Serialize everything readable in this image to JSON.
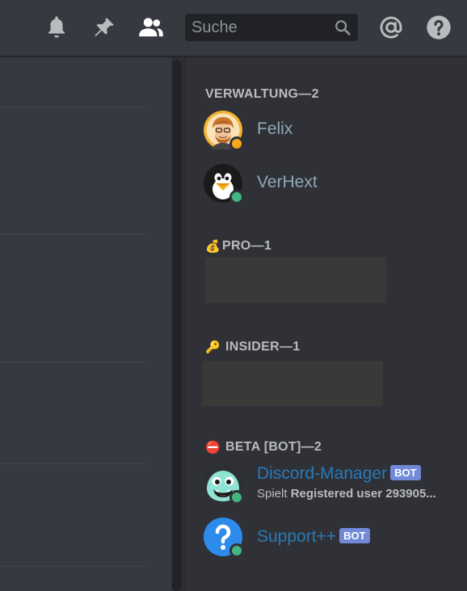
{
  "toolbar": {
    "search_placeholder": "Suche",
    "icons": [
      "bell-icon",
      "pin-icon",
      "members-icon",
      "search-icon",
      "mention-icon",
      "help-icon"
    ]
  },
  "members": {
    "groups": [
      {
        "header": "VERWALTUNG—2",
        "members": [
          {
            "name": "Felix",
            "status": "idle",
            "avatar": "bitmoji-avatar"
          },
          {
            "name": "VerHext",
            "status": "online",
            "avatar": "penguin-avatar"
          }
        ]
      },
      {
        "header": "PRO—1",
        "emoji": "💰",
        "members": []
      },
      {
        "header": "INSIDER—1",
        "emoji": "🔑",
        "members": []
      },
      {
        "header": "BETA [BOT]—2",
        "emoji": "⛔",
        "members": [
          {
            "name": "Discord-Manager",
            "badge": "BOT",
            "status": "online",
            "activity_prefix": "Spielt",
            "activity_value": "Registered user 293905...",
            "avatar": "monster-avatar"
          },
          {
            "name": "Support++",
            "badge": "BOT",
            "status": "online",
            "avatar": "question-avatar"
          }
        ]
      }
    ]
  },
  "colors": {
    "online": "#43b581",
    "idle": "#faa61a",
    "bot_badge": "#7289da",
    "bot_name": "#2979b8",
    "admin_name": "#8fa8b8"
  }
}
